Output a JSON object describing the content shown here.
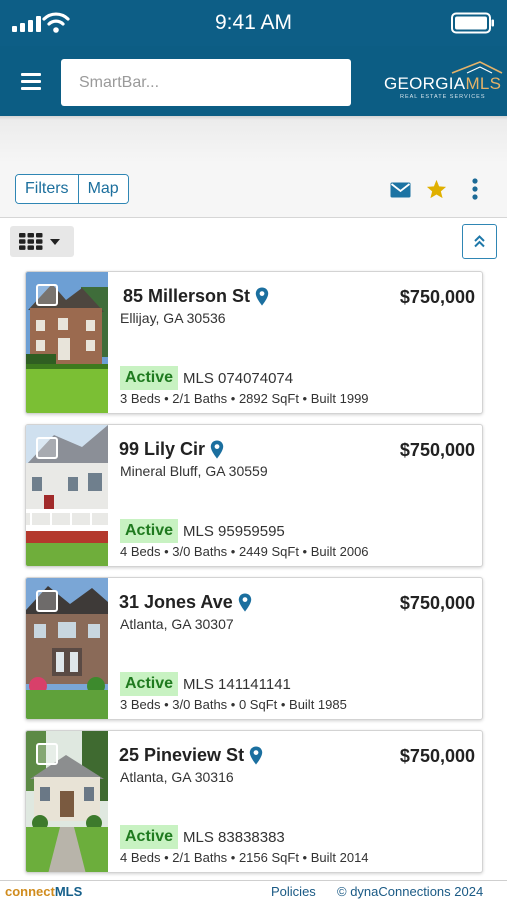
{
  "status_bar": {
    "time": "9:41 AM",
    "icons": [
      "signal-bars-icon",
      "wifi-icon",
      "battery-icon"
    ]
  },
  "header": {
    "menu_icon": "hamburger-icon",
    "search_placeholder": "SmartBar...",
    "logo": {
      "brand_first": "GEORGIA",
      "brand_second": "MLS",
      "tagline": "REAL ESTATE SERVICES"
    }
  },
  "toolbar": {
    "filters_label": "Filters",
    "map_label": "Map",
    "icons": [
      "envelope-icon",
      "star-icon",
      "more-vertical-icon"
    ]
  },
  "actions": {
    "view_icon": "grid-view-icon",
    "collapse_icon": "chevron-double-up-icon"
  },
  "listings": [
    {
      "address": "85 Millerson St",
      "city": "Ellijay, GA 30536",
      "price": "$750,000",
      "status": "Active",
      "mls": "MLS 074074074",
      "details": "3 Beds • 2/1 Baths • 2892 SqFt • Built 1999"
    },
    {
      "address": "99 Lily Cir",
      "city": "Mineral Bluff, GA 30559",
      "price": "$750,000",
      "status": "Active",
      "mls": "MLS 95959595",
      "details": "4 Beds • 3/0 Baths • 2449 SqFt • Built 2006"
    },
    {
      "address": "31 Jones Ave",
      "city": "Atlanta, GA 30307",
      "price": "$750,000",
      "status": "Active",
      "mls": "MLS 141141141",
      "details": "3 Beds • 3/0 Baths • 0 SqFt • Built 1985"
    },
    {
      "address": "25 Pineview St",
      "city": "Atlanta, GA 30316",
      "price": "$750,000",
      "status": "Active",
      "mls": "MLS 83838383",
      "details": "4 Beds • 2/1 Baths • 2156 SqFt • Built 2014"
    }
  ],
  "footer": {
    "brand_first": "connect",
    "brand_second": "MLS",
    "policies": "Policies",
    "copyright": "© dynaConnections 2024"
  },
  "colors": {
    "header": "#0c5d84",
    "accent": "#2f86b4",
    "active_badge": "#c8f2c2",
    "star": "#e0b000",
    "logo_gold": "#e4b269"
  }
}
